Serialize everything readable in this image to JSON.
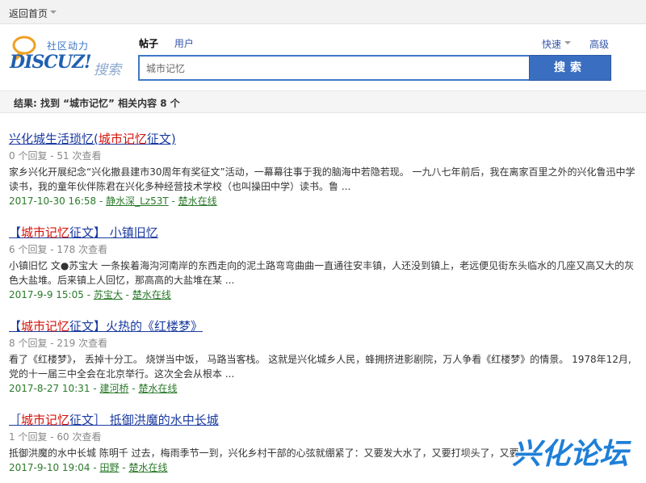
{
  "topbar": {
    "back_label": "返回首页"
  },
  "logo": {
    "tagline": "社区动力",
    "brand": "DISCUZ!",
    "search_word": "搜索"
  },
  "search": {
    "tabs": [
      {
        "label": "帖子",
        "active": true
      },
      {
        "label": "用户",
        "active": false
      }
    ],
    "value": "城市记忆",
    "button_label": "搜索",
    "quick_label": "快速",
    "advanced_label": "高级"
  },
  "result_summary": "结果: 找到 “城市记忆” 相关内容 8 个",
  "results": [
    {
      "title_pre": "兴化城生活琐忆(",
      "title_hl": "城市记忆",
      "title_post": "征文)",
      "meta": "0 个回复 - 51 次查看",
      "snippet": "家乡兴化开展纪念“兴化撤县建市30周年有奖征文”活动，一幕幕往事于我的脑海中若隐若现。 一九八七年前后，我在离家百里之外的兴化鲁迅中学读书，我的童年伙伴陈君在兴化多种经营技术学校（也叫操田中学）读书。鲁 ...",
      "date": "2017-10-30 16:58",
      "author": "静水深_Lz53T",
      "forum": "楚水在线"
    },
    {
      "title_pre": "【",
      "title_hl": "城市记忆",
      "title_post": "征文】 小镇旧忆",
      "meta": "6 个回复 - 178 次查看",
      "snippet": "小镇旧忆        文●苏宝大        一条挨着海沟河南岸的东西走向的泥土路弯弯曲曲一直通往安丰镇，人还没到镇上，老远便见街东头临水的几座又高又大的灰色大盐堆。后来镇上人回忆，那高高的大盐堆在某 ...",
      "date": "2017-9-9 15:05",
      "author": "苏宝大",
      "forum": "楚水在线"
    },
    {
      "title_pre": "【",
      "title_hl": "城市记忆",
      "title_post": "征文】火热的《红楼梦》",
      "meta": "8 个回复 - 219 次查看",
      "snippet": "看了《红楼梦》，    丢掉十分工。    烧饼当中饭，    马路当客栈。    这就是兴化城乡人民，蜂拥挤进影剧院，万人争看《红楼梦》的情景。 1978年12月,党的十一届三中全会在北京举行。这次全会从根本 ...",
      "date": "2017-8-27 10:31",
      "author": "建河桥",
      "forum": "楚水在线"
    },
    {
      "title_pre": "［",
      "title_hl": "城市记忆",
      "title_post": "征文］ 抵御洪魔的水中长城",
      "meta": "1 个回复 - 60 次查看",
      "snippet": "抵御洪魔的水中长城 陈明千 过去，梅雨季节一到，兴化乡村干部的心弦就绷紧了：又要发大水了，又要打坝头了，又要 ...",
      "date": "2017-9-10 19:04",
      "author": "田野",
      "forum": "楚水在线"
    }
  ],
  "watermark": {
    "text": "兴化论坛"
  },
  "colors": {
    "accent": "#3a6ec0",
    "highlight": "#d4110a",
    "link": "#1a3aa0",
    "footer_green": "#2b7a2b"
  }
}
